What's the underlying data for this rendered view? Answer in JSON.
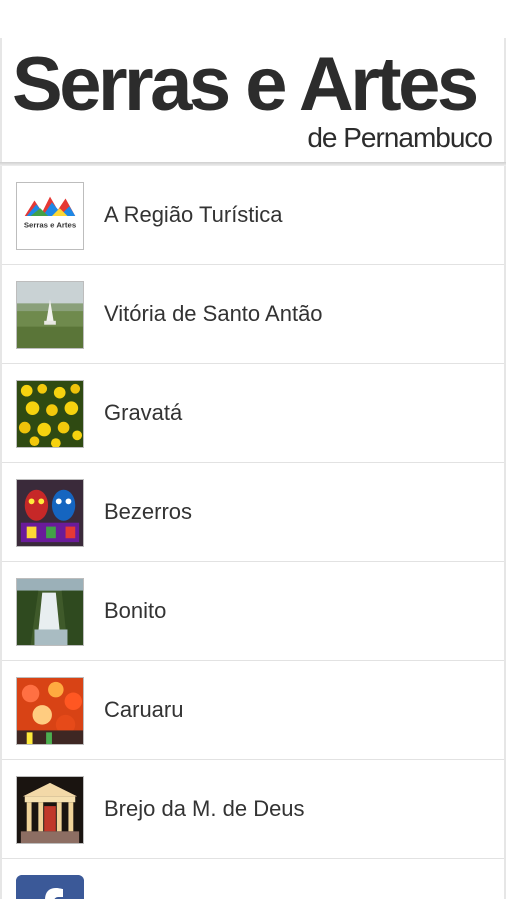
{
  "header": {
    "title": "Serras e Artes",
    "subtitle": "de Pernambuco"
  },
  "menu": {
    "items": [
      {
        "label": "A Região Turística",
        "icon": "regiao-logo-icon"
      },
      {
        "label": "Vitória de Santo Antão",
        "icon": "vitoria-photo-icon"
      },
      {
        "label": "Gravatá",
        "icon": "gravata-flowers-icon"
      },
      {
        "label": "Bezerros",
        "icon": "bezerros-masks-icon"
      },
      {
        "label": "Bonito",
        "icon": "bonito-waterfall-icon"
      },
      {
        "label": "Caruaru",
        "icon": "caruaru-festival-icon"
      },
      {
        "label": "Brejo da M. de Deus",
        "icon": "brejo-theater-icon"
      },
      {
        "label": "",
        "icon": "facebook-icon"
      }
    ],
    "logo_small_text": {
      "line1": "Serras e Artes"
    }
  },
  "colors": {
    "title": "#2c2c2c",
    "label": "#333333",
    "divider": "#e2e2e2",
    "facebook": "#3b5998"
  }
}
